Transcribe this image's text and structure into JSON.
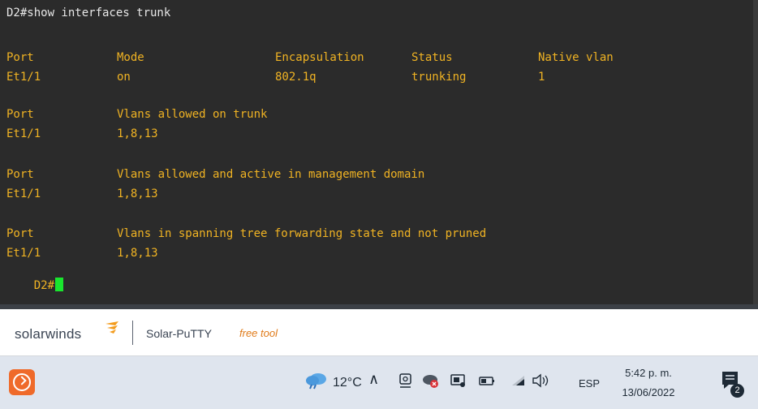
{
  "terminal": {
    "prompt_command": "D2#show interfaces trunk",
    "table1": {
      "headers": [
        "Port",
        "Mode",
        "Encapsulation",
        "Status",
        "Native vlan"
      ],
      "row": [
        "Et1/1",
        "on",
        "802.1q",
        "trunking",
        "1"
      ]
    },
    "table2": {
      "headers": [
        "Port",
        "Vlans allowed on trunk"
      ],
      "row": [
        "Et1/1",
        "1,8,13"
      ]
    },
    "table3": {
      "headers": [
        "Port",
        "Vlans allowed and active in management domain"
      ],
      "row": [
        "Et1/1",
        "1,8,13"
      ]
    },
    "table4": {
      "headers": [
        "Port",
        "Vlans in spanning tree forwarding state and not pruned"
      ],
      "row": [
        "Et1/1",
        "1,8,13"
      ]
    },
    "final_prompt": "D2#",
    "colors": {
      "background": "#2b2b2b",
      "command_text": "#e8e8e8",
      "output_text": "#f0b323",
      "cursor": "#19e62e"
    }
  },
  "brandbar": {
    "logo": "solarwinds",
    "product": "Solar-PuTTY",
    "free_label": "free tool",
    "colors": {
      "free_label": "#e07b1a",
      "flame": "#f39c1e"
    }
  },
  "taskbar": {
    "app_icon": "solar-putty-app-icon",
    "temperature": "12°C",
    "language": "ESP",
    "time": "5:42 p. m.",
    "date": "13/06/2022",
    "notification_count": "2",
    "tray_icons": [
      "chevron-up-icon",
      "meet-now-icon",
      "vpn-shield-icon",
      "screen-share-icon",
      "battery-icon",
      "wifi-icon",
      "speaker-icon"
    ]
  }
}
